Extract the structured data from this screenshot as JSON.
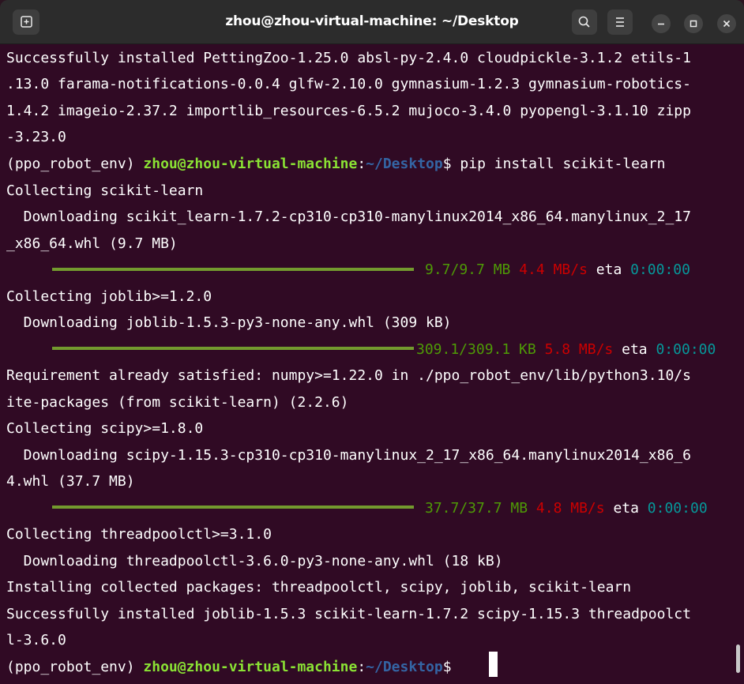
{
  "window": {
    "title": "zhou@zhou-virtual-machine: ~/Desktop"
  },
  "icons": {
    "new_tab": "new-tab-icon",
    "search": "search-icon",
    "menu": "hamburger-menu-icon",
    "minimize": "minimize-icon",
    "maximize": "maximize-icon",
    "close": "close-icon"
  },
  "colors": {
    "background": "#300a24",
    "prompt_user": "#8ae234",
    "prompt_path": "#3465a4",
    "progress_bar": "#739a2e",
    "progress_done": "#4e9a06",
    "progress_rate": "#cc0000",
    "progress_eta": "#06989a"
  },
  "terminal": {
    "l1": "Successfully installed PettingZoo-1.25.0 absl-py-2.4.0 cloudpickle-3.1.2 etils-1",
    "l2": ".13.0 farama-notifications-0.0.4 glfw-2.10.0 gymnasium-1.2.3 gymnasium-robotics-",
    "l3": "1.4.2 imageio-2.37.2 importlib_resources-6.5.2 mujoco-3.4.0 pyopengl-3.1.10 zipp",
    "l4": "-3.23.0",
    "prompt1": {
      "env": "(ppo_robot_env) ",
      "user": "zhou@zhou-virtual-machine",
      "colon": ":",
      "path": "~/Desktop",
      "sign": "$ ",
      "command": "pip install scikit-learn"
    },
    "l6": "Collecting scikit-learn",
    "l7": "  Downloading scikit_learn-1.7.2-cp310-cp310-manylinux2014_x86_64.manylinux_2_17",
    "l8": "_x86_64.whl (9.7 MB)",
    "p1": {
      "done": "9.7/9.7 MB",
      "rate": "4.4 MB/s",
      "eta_label": "eta",
      "eta": "0:00:00"
    },
    "l10": "Collecting joblib>=1.2.0",
    "l11": "  Downloading joblib-1.5.3-py3-none-any.whl (309 kB)",
    "p2": {
      "done": "309.1/309.1 KB",
      "rate": "5.8 MB/s",
      "eta_label": "eta",
      "eta": "0:00:00"
    },
    "l13": "Requirement already satisfied: numpy>=1.22.0 in ./ppo_robot_env/lib/python3.10/s",
    "l14": "ite-packages (from scikit-learn) (2.2.6)",
    "l15": "Collecting scipy>=1.8.0",
    "l16": "  Downloading scipy-1.15.3-cp310-cp310-manylinux_2_17_x86_64.manylinux2014_x86_6",
    "l17": "4.whl (37.7 MB)",
    "p3": {
      "done": "37.7/37.7 MB",
      "rate": "4.8 MB/s",
      "eta_label": "eta",
      "eta": "0:00:00"
    },
    "l19": "Collecting threadpoolctl>=3.1.0",
    "l20": "  Downloading threadpoolctl-3.6.0-py3-none-any.whl (18 kB)",
    "l21": "Installing collected packages: threadpoolctl, scipy, joblib, scikit-learn",
    "l22": "Successfully installed joblib-1.5.3 scikit-learn-1.7.2 scipy-1.15.3 threadpoolct",
    "l23": "l-3.6.0",
    "prompt2": {
      "env": "(ppo_robot_env) ",
      "user": "zhou@zhou-virtual-machine",
      "colon": ":",
      "path": "~/Desktop",
      "sign": "$ "
    }
  }
}
